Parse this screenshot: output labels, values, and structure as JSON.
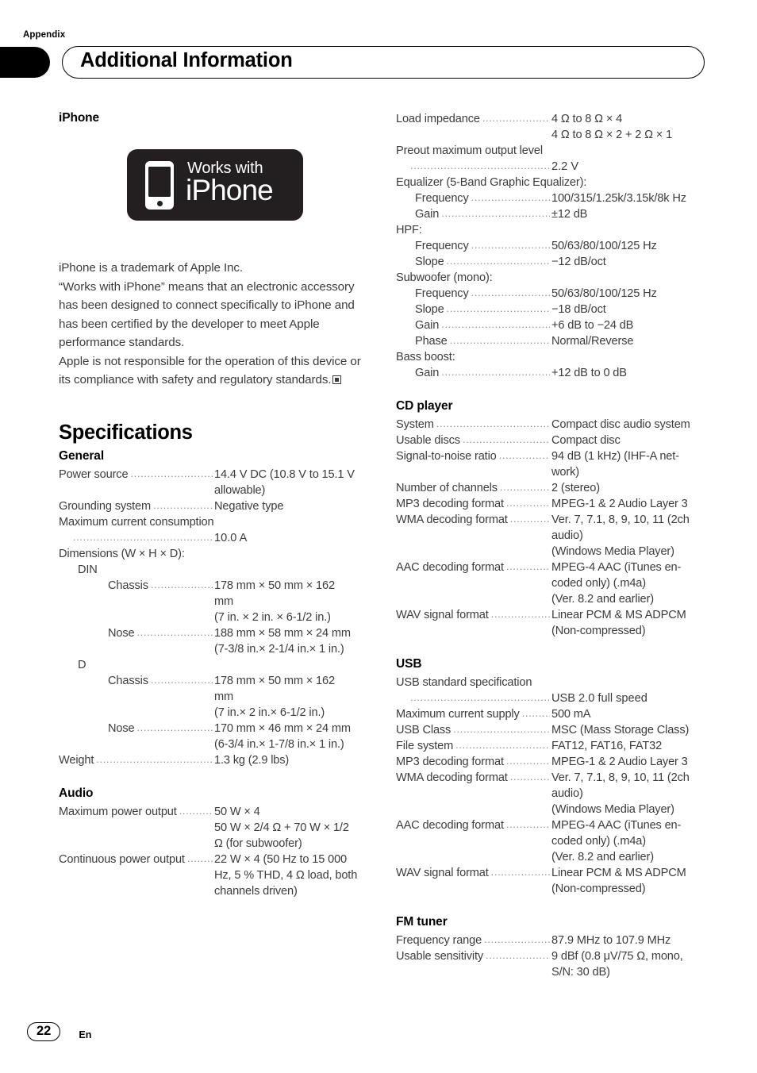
{
  "header": {
    "appendix_label": "Appendix",
    "title": "Additional Information"
  },
  "footer": {
    "page_number": "22",
    "language_code": "En"
  },
  "left_column": {
    "iphone_heading": "iPhone",
    "badge": {
      "line1": "Works with",
      "line2": "iPhone",
      "icon": "iphone-device-icon"
    },
    "trademark_paragraph_1": "iPhone is a trademark of Apple Inc.",
    "trademark_paragraph_2": "“Works with iPhone” means that an electronic accessory has been designed to connect specifically to iPhone and has been certified by the developer to meet Apple performance standards.",
    "trademark_paragraph_3": "Apple is not responsible for the operation of this device or its compliance with safety and regulatory standards.",
    "specifications_heading": "Specifications",
    "general_heading": "General",
    "general": {
      "power_source_label": "Power source",
      "power_source_value": "14.4 V DC (10.8 V to 15.1 V",
      "power_source_value_cont": "allowable)",
      "grounding_label": "Grounding system",
      "grounding_value": "Negative type",
      "max_current_label": "Maximum current consumption",
      "max_current_value": "10.0 A",
      "dimensions_label": "Dimensions (W × H × D):",
      "din_label": "DIN",
      "din_chassis_label": "Chassis",
      "din_chassis_value": "178 mm × 50 mm × 162",
      "din_chassis_value_cont1": "mm",
      "din_chassis_value_cont2": "(7 in. × 2 in. × 6-1/2 in.)",
      "din_nose_label": "Nose",
      "din_nose_value": "188 mm × 58 mm × 24 mm",
      "din_nose_value_cont": "(7-3/8 in.× 2-1/4 in.× 1 in.)",
      "d_label": "D",
      "d_chassis_label": "Chassis",
      "d_chassis_value": "178 mm × 50 mm × 162",
      "d_chassis_value_cont1": "mm",
      "d_chassis_value_cont2": "(7 in.× 2 in.× 6-1/2 in.)",
      "d_nose_label": "Nose",
      "d_nose_value": "170 mm × 46 mm × 24 mm",
      "d_nose_value_cont": "(6-3/4 in.× 1-7/8 in.× 1 in.)",
      "weight_label": "Weight",
      "weight_value": "1.3 kg (2.9 lbs)"
    },
    "audio_heading": "Audio",
    "audio": {
      "max_power_label": "Maximum power output",
      "max_power_value": "50 W × 4",
      "max_power_value_cont1": "50 W × 2/4 Ω + 70 W × 1/2",
      "max_power_value_cont2": "Ω (for subwoofer)",
      "cont_power_label": "Continuous power output",
      "cont_power_value": "22 W × 4 (50 Hz to 15 000",
      "cont_power_value_cont1": "Hz, 5 % THD, 4 Ω load, both",
      "cont_power_value_cont2": "channels driven)"
    }
  },
  "right_column": {
    "audio_continued": {
      "load_impedance_label": "Load impedance",
      "load_impedance_value": "4 Ω to 8 Ω × 4",
      "load_impedance_value_cont": "4 Ω to 8 Ω × 2 + 2 Ω × 1",
      "preout_label": "Preout maximum output level",
      "preout_value": "2.2 V",
      "equalizer_label": "Equalizer (5-Band Graphic Equalizer):",
      "eq_frequency_label": "Frequency",
      "eq_frequency_value": "100/315/1.25k/3.15k/8k Hz",
      "eq_gain_label": "Gain",
      "eq_gain_value": "±12 dB",
      "hpf_label": "HPF:",
      "hpf_frequency_label": "Frequency",
      "hpf_frequency_value": "50/63/80/100/125 Hz",
      "hpf_slope_label": "Slope",
      "hpf_slope_value": "−12 dB/oct",
      "subwoofer_label": "Subwoofer (mono):",
      "sw_frequency_label": "Frequency",
      "sw_frequency_value": "50/63/80/100/125 Hz",
      "sw_slope_label": "Slope",
      "sw_slope_value": "−18 dB/oct",
      "sw_gain_label": "Gain",
      "sw_gain_value": "+6 dB to −24 dB",
      "sw_phase_label": "Phase",
      "sw_phase_value": "Normal/Reverse",
      "bass_boost_label": "Bass boost:",
      "bb_gain_label": "Gain",
      "bb_gain_value": "+12 dB to 0 dB"
    },
    "cd_player_heading": "CD player",
    "cd_player": {
      "system_label": "System",
      "system_value": "Compact disc audio system",
      "usable_discs_label": "Usable discs",
      "usable_discs_value": "Compact disc",
      "snr_label": "Signal-to-noise ratio",
      "snr_value": "94 dB (1 kHz) (IHF-A net-",
      "snr_value_cont": "work)",
      "channels_label": "Number of channels",
      "channels_value": "2 (stereo)",
      "mp3_label": "MP3 decoding format",
      "mp3_value": "MPEG-1 & 2 Audio Layer 3",
      "wma_label": "WMA decoding format",
      "wma_value": "Ver. 7, 7.1, 8, 9, 10, 11 (2ch",
      "wma_value_cont1": "audio)",
      "wma_value_cont2": "(Windows Media Player)",
      "aac_label": "AAC decoding format",
      "aac_value": "MPEG-4 AAC (iTunes en-",
      "aac_value_cont1": "coded only) (.m4a)",
      "aac_value_cont2": "(Ver. 8.2 and earlier)",
      "wav_label": "WAV signal format",
      "wav_value": "Linear PCM & MS ADPCM",
      "wav_value_cont": "(Non-compressed)"
    },
    "usb_heading": "USB",
    "usb": {
      "standard_label": "USB standard specification",
      "standard_value": "USB 2.0 full speed",
      "max_current_label": "Maximum current supply",
      "max_current_value": "500 mA",
      "usb_class_label": "USB Class",
      "usb_class_value": "MSC (Mass Storage Class)",
      "file_system_label": "File system",
      "file_system_value": "FAT12, FAT16, FAT32",
      "mp3_label": "MP3 decoding format",
      "mp3_value": "MPEG-1 & 2 Audio Layer 3",
      "wma_label": "WMA decoding format",
      "wma_value": "Ver. 7, 7.1, 8, 9, 10, 11 (2ch",
      "wma_value_cont1": "audio)",
      "wma_value_cont2": "(Windows Media Player)",
      "aac_label": "AAC decoding format",
      "aac_value": "MPEG-4 AAC (iTunes en-",
      "aac_value_cont1": "coded only) (.m4a)",
      "aac_value_cont2": "(Ver. 8.2 and earlier)",
      "wav_label": "WAV signal format",
      "wav_value": "Linear PCM & MS ADPCM",
      "wav_value_cont": "(Non-compressed)"
    },
    "fm_tuner_heading": "FM tuner",
    "fm_tuner": {
      "frequency_range_label": "Frequency range",
      "frequency_range_value": "87.9 MHz to 107.9 MHz",
      "sensitivity_label": "Usable sensitivity",
      "sensitivity_value": "9 dBf (0.8 μV/75 Ω, mono,",
      "sensitivity_value_cont": "S/N: 30 dB)"
    }
  },
  "leader": "............................................................"
}
